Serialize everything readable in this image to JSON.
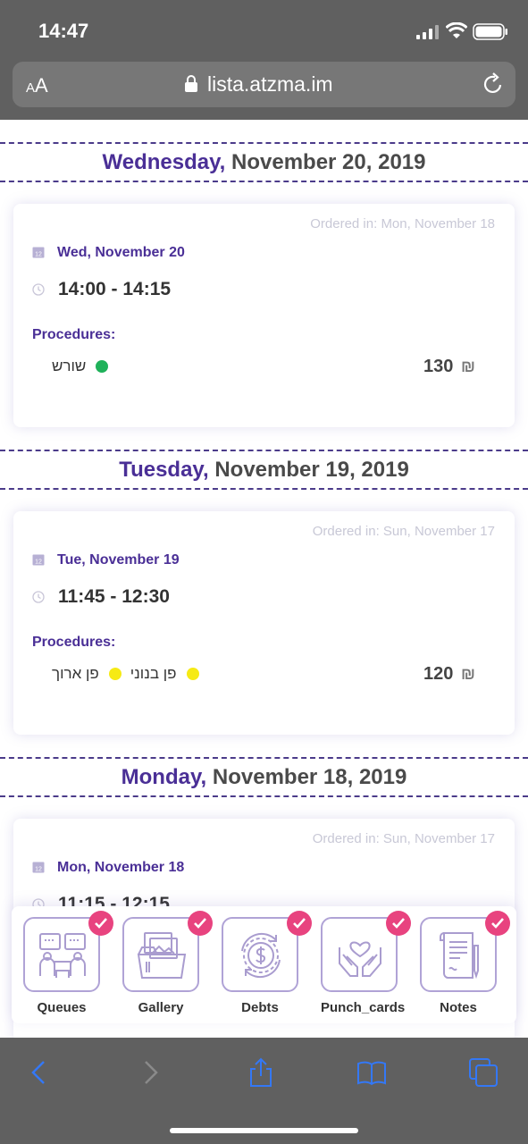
{
  "status_bar": {
    "time": "14:47"
  },
  "browser": {
    "text_size_label": "AA",
    "url": "lista.atzma.im"
  },
  "appointments": [
    {
      "header_day": "Wednesday,",
      "header_date": "November 20, 2019",
      "ordered": "Ordered in: Mon, November 18",
      "date": "Wed, November 20",
      "time": "14:00 - 14:15",
      "procedures_label": "Procedures:",
      "procedures": [
        {
          "name": "שורש",
          "color": "#1fb15a"
        }
      ],
      "price": "130",
      "currency": "₪"
    },
    {
      "header_day": "Tuesday,",
      "header_date": "November 19, 2019",
      "ordered": "Ordered in: Sun, November 17",
      "date": "Tue, November 19",
      "time": "11:45 - 12:30",
      "procedures_label": "Procedures:",
      "procedures": [
        {
          "name": "פן בנוני",
          "color": "#f6ea14"
        },
        {
          "name": "פן ארוך",
          "color": "#f6ea14"
        }
      ],
      "price": "120",
      "currency": "₪"
    },
    {
      "header_day": "Monday,",
      "header_date": "November 18, 2019",
      "ordered": "Ordered in: Sun, November 17",
      "date": "Mon, November 18",
      "time": "11:15 - 12:15"
    }
  ],
  "tools": [
    {
      "label": "Queues",
      "icon": "queues-icon"
    },
    {
      "label": "Gallery",
      "icon": "gallery-icon"
    },
    {
      "label": "Debts",
      "icon": "debts-icon"
    },
    {
      "label": "Punch_cards",
      "icon": "punch-cards-icon"
    },
    {
      "label": "Notes",
      "icon": "notes-icon"
    }
  ],
  "colors": {
    "accent": "#4a2f96",
    "check": "#e8437f",
    "icon_stroke": "#a99ccf",
    "chrome": "#606060",
    "link": "#3478f6"
  }
}
